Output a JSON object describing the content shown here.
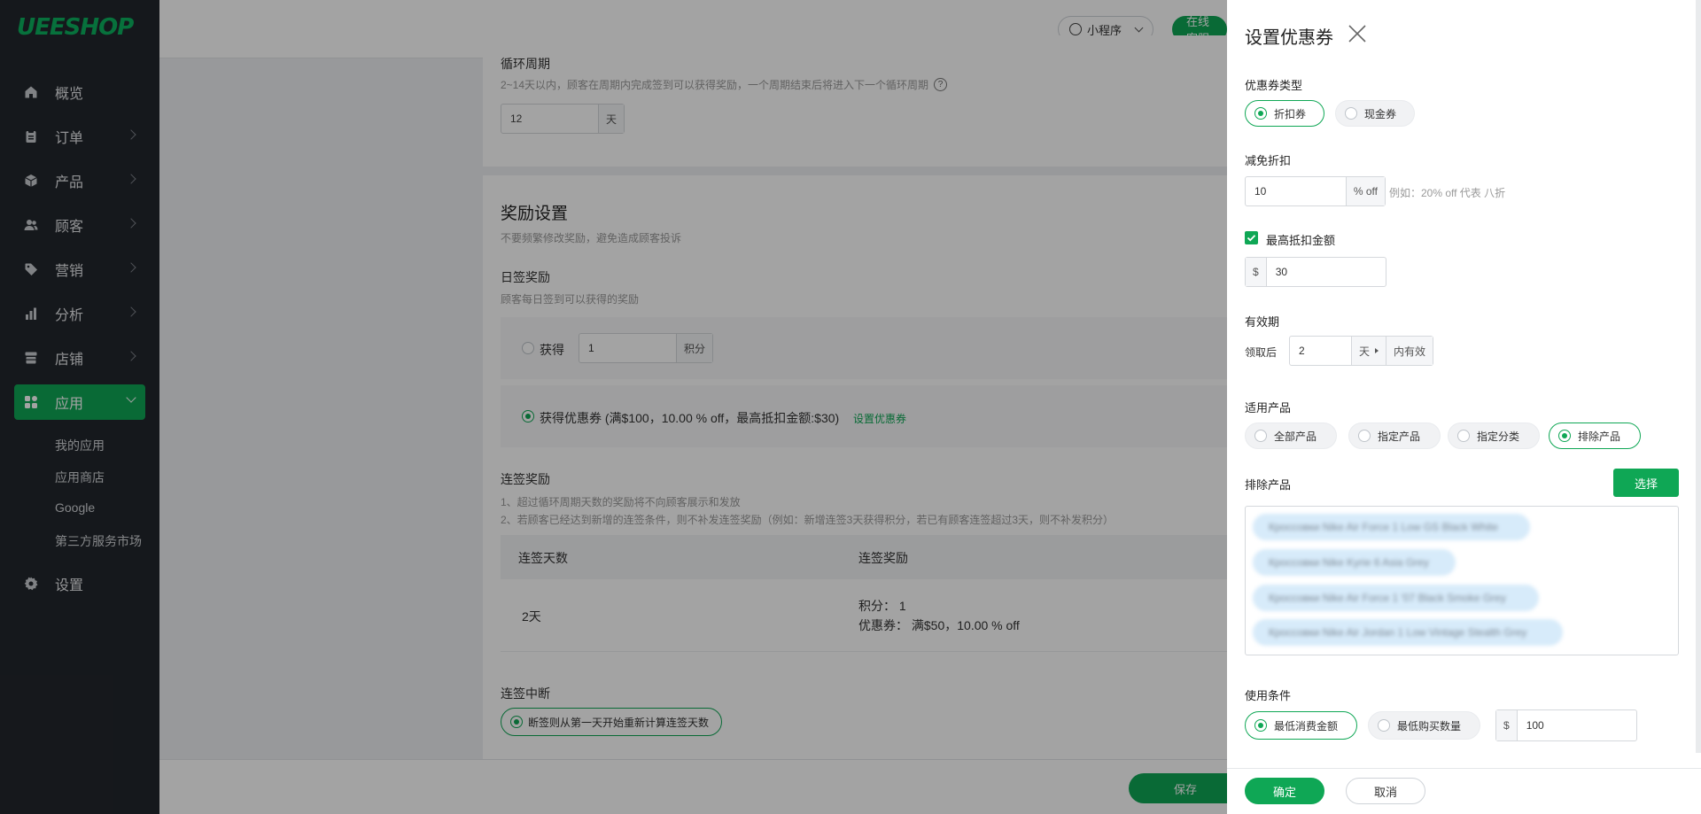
{
  "sidebar": {
    "logo": "UEESHOP",
    "items": [
      {
        "label": "概览",
        "icon": "home-icon"
      },
      {
        "label": "订单",
        "icon": "clipboard-icon"
      },
      {
        "label": "产品",
        "icon": "box-icon"
      },
      {
        "label": "顾客",
        "icon": "users-icon"
      },
      {
        "label": "营销",
        "icon": "tag-icon"
      },
      {
        "label": "分析",
        "icon": "bar-chart-icon"
      },
      {
        "label": "店铺",
        "icon": "store-icon"
      },
      {
        "label": "应用",
        "icon": "apps-icon"
      }
    ],
    "subitems": [
      "我的应用",
      "应用商店",
      "Google",
      "第三方服务市场"
    ],
    "settings": {
      "label": "设置",
      "icon": "gear-icon"
    }
  },
  "topbar": {
    "miniprogram": "小程序",
    "online_service": "在线客服"
  },
  "cycle": {
    "title": "循环周期",
    "desc": "2~14天以内，顾客在周期内完成签到可以获得奖励，一个周期结束后将进入下一个循环周期",
    "value": "12",
    "unit": "天"
  },
  "reward": {
    "title": "奖励设置",
    "desc": "不要频繁修改奖励，避免造成顾客投诉",
    "daily_title": "日签奖励",
    "daily_desc": "顾客每日签到可以获得的奖励",
    "points_label": "获得",
    "points_value": "1",
    "points_unit": "积分",
    "coupon_text": "获得优惠券 (满$100，10.00 % off，最高抵扣金额:$30)",
    "coupon_link": "设置优惠券",
    "streak_title": "连签奖励",
    "streak_note1": "1、超过循环周期天数的奖励将不向顾客展示和发放",
    "streak_note2": "2、若顾客已经达到新增的连签条件，则不补发连签奖励（例如：新增连签3天获得积分，若已有顾客连签超过3天，则不补发积分）",
    "table_headers": [
      "连签天数",
      "连签奖励"
    ],
    "rows": [
      {
        "days": "2天",
        "points": "积分：  1",
        "coupon": "优惠券：  满$50，10.00 % off"
      }
    ],
    "break_title": "连签中断",
    "break_option": "断签则从第一天开始重新计算连签天数",
    "save": "保存"
  },
  "dialog": {
    "title": "设置优惠券",
    "coupon_type_label": "优惠券类型",
    "coupon_types": [
      "折扣券",
      "现金券"
    ],
    "coupon_type_selected": 0,
    "discount_label": "减免折扣",
    "discount_value": "10",
    "discount_unit": "% off",
    "discount_hint": "例如：20% off 代表 八折",
    "max_label": "最高抵扣金额",
    "max_checked": true,
    "currency": "$",
    "max_value": "30",
    "validity_label": "有效期",
    "validity_prefix": "领取后",
    "validity_value": "2",
    "validity_unit": "天",
    "validity_suffix": "内有效",
    "products_label": "适用产品",
    "product_options": [
      "全部产品",
      "指定产品",
      "指定分类",
      "排除产品"
    ],
    "product_selected": 3,
    "excluded_label": "排除产品",
    "select_button": "选择",
    "excluded_items": [
      "Кроссовки Nike Air Force 1 Low GS Black White",
      "Кроссовки Nike Kyrie 6 Asia Grey",
      "Кроссовки Nike Air Force 1 '07 Black Smoke Grey",
      "Кроссовки Nike Air Jordan 1 Low Vintage Stealth Grey"
    ],
    "condition_label": "使用条件",
    "condition_options": [
      "最低消费金额",
      "最低购买数量"
    ],
    "condition_selected": 0,
    "condition_value": "100",
    "confirm": "确定",
    "cancel": "取消"
  },
  "colors": {
    "accent": "#0fa755",
    "sidebar": "#22262c",
    "tag": "#d7ebfa"
  }
}
